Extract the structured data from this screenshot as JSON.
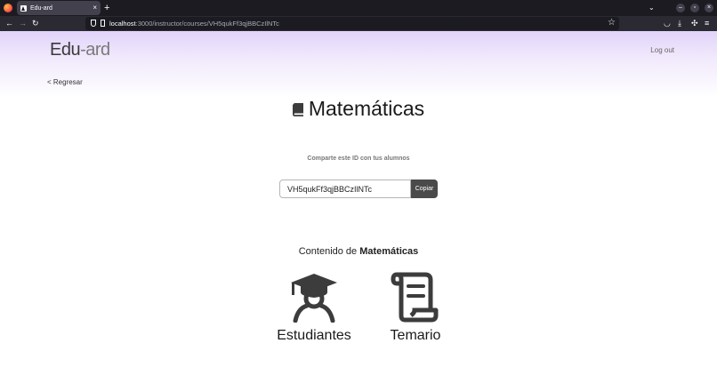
{
  "browser": {
    "tab_title": "Edu-ard",
    "tab_close": "×",
    "new_tab": "+",
    "url_host": "localhost",
    "url_path": ":3000/instructor/courses/VH5qukFf3qjBBCzIlNTc"
  },
  "header": {
    "logo_main": "Edu",
    "logo_sep": "-",
    "logo_end": "ard",
    "logout_label": "Log out"
  },
  "nav": {
    "back_label": "< Regresar"
  },
  "course": {
    "title": "Matemáticas",
    "share_label": "Comparte este ID con tus alumnos",
    "course_id": "VH5qukFf3qjBBCzIlNTc",
    "copy_label": "Copiar"
  },
  "content": {
    "prefix": "Contenido de ",
    "course_name": "Matemáticas",
    "cards": [
      {
        "label": "Estudiantes",
        "icon": "graduate-student-icon"
      },
      {
        "label": "Temario",
        "icon": "scroll-icon"
      }
    ]
  },
  "colors": {
    "gradient_top": "#e1d3fa",
    "button_bg": "#4a4a4a",
    "icon": "#3c3c3c"
  }
}
